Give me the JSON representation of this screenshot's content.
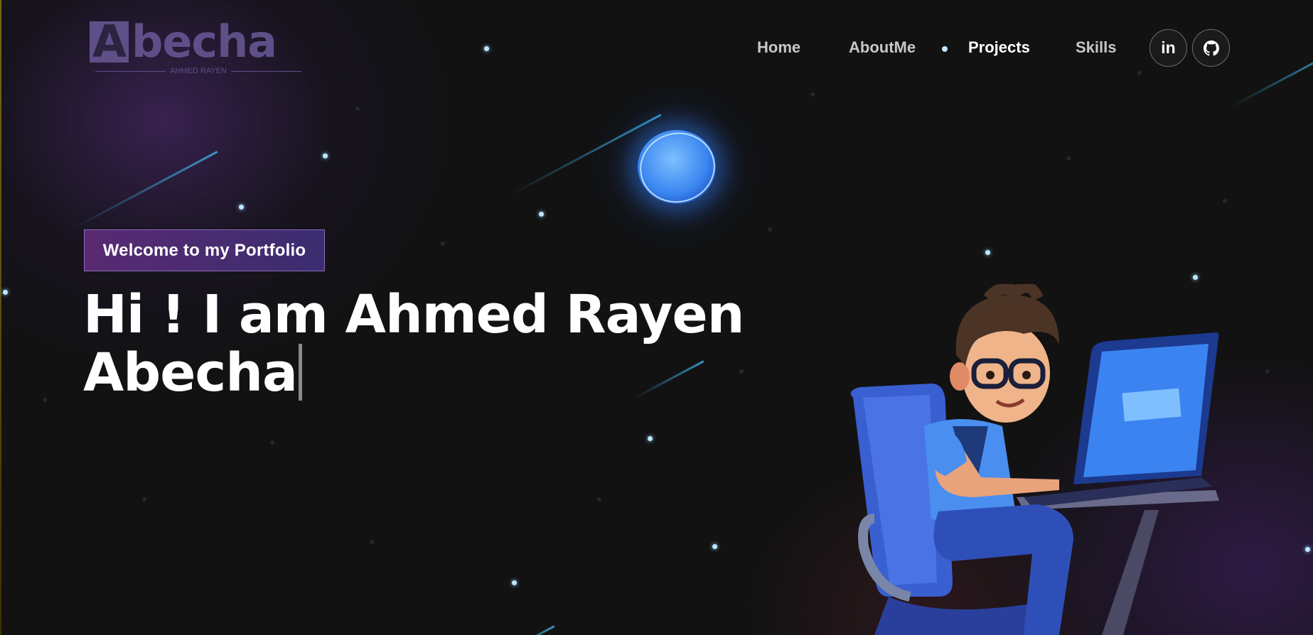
{
  "logo": {
    "initial": "A",
    "rest": "becha",
    "subtitle": "AHMED RAYEN"
  },
  "nav": {
    "items": [
      {
        "label": "Home",
        "active": false
      },
      {
        "label": "AboutMe",
        "active": false
      },
      {
        "label": "Projects",
        "active": true
      },
      {
        "label": "Skills",
        "active": false
      }
    ],
    "social": [
      {
        "name": "linkedin-icon",
        "glyph": "in"
      },
      {
        "name": "github-icon"
      }
    ]
  },
  "hero": {
    "badge": "Welcome to my Portfolio",
    "headline_line1": "Hi ! I am Ahmed Rayen",
    "headline_line2": "Abecha"
  },
  "colors": {
    "background": "#121212",
    "logo": "#5e4f88",
    "badge_gradient_start": "#5a2a72",
    "badge_gradient_end": "#3a2d70",
    "star": "#bfe6ff",
    "orb": "#3b86f0"
  }
}
